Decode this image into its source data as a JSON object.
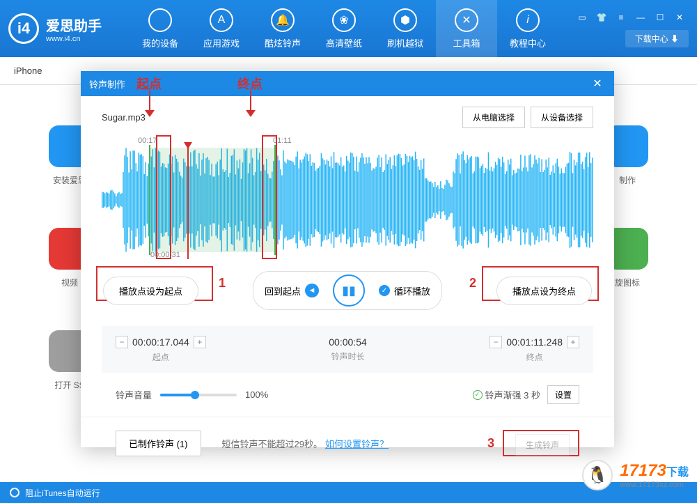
{
  "app": {
    "name": "爱思助手",
    "url": "www.i4.cn",
    "logo_text": "i4"
  },
  "nav": [
    {
      "label": "我的设备",
      "icon": "apple"
    },
    {
      "label": "应用游戏",
      "icon": "app"
    },
    {
      "label": "酷炫铃声",
      "icon": "bell"
    },
    {
      "label": "高清壁纸",
      "icon": "flower"
    },
    {
      "label": "刷机越狱",
      "icon": "box"
    },
    {
      "label": "工具箱",
      "icon": "tools",
      "active": true
    },
    {
      "label": "教程中心",
      "icon": "info"
    }
  ],
  "header": {
    "download_center": "下载中心"
  },
  "device_tab": "iPhone",
  "bg_tools_left": [
    "安装爱思",
    "视频",
    "打开 SS"
  ],
  "bg_tools_right": [
    "制作",
    "旋图标"
  ],
  "modal": {
    "title": "铃声制作",
    "annotations": {
      "start": "起点",
      "end": "终点"
    },
    "file_name": "Sugar.mp3",
    "btn_from_computer": "从电脑选择",
    "btn_from_device": "从设备选择",
    "wave": {
      "start_label": "00:17",
      "end_label": "01:11",
      "play_time": "00:00:31"
    },
    "btn_set_start": "播放点设为起点",
    "btn_back_start": "回到起点",
    "btn_loop_play": "循环播放",
    "btn_set_end": "播放点设为终点",
    "num_labels": {
      "n1": "1",
      "n2": "2",
      "n3": "3"
    },
    "time_panel": {
      "start_time": "00:00:17.044",
      "start_label": "起点",
      "duration": "00:00:54",
      "duration_label": "铃声时长",
      "end_time": "00:01:11.248",
      "end_label": "终点"
    },
    "volume": {
      "label": "铃声音量",
      "value": "100%",
      "percent": 45
    },
    "fade": {
      "label": "铃声渐强 3 秒",
      "settings": "设置"
    },
    "footer": {
      "made_btn": "已制作铃声 (1)",
      "hint": "短信铃声不能超过29秒。",
      "link": "如何设置铃声？",
      "generate": "生成铃声"
    }
  },
  "status_bar": "阻止iTunes自动运行",
  "watermark": {
    "brand": "17173",
    "sub": "下载",
    "url": "www.17173xz.com"
  }
}
